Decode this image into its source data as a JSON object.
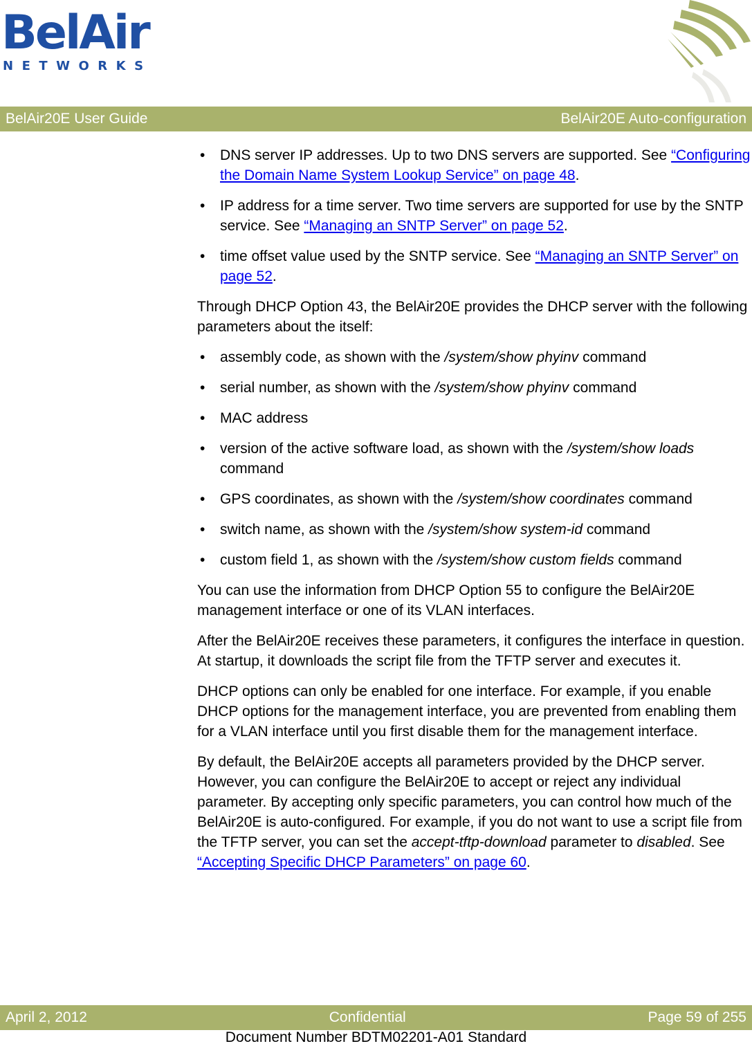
{
  "logo": {
    "brand": "BelAir",
    "sub": "NETWORKS",
    "color": "#1f4fa3"
  },
  "header": {
    "left": "BelAir20E User Guide",
    "right": "BelAir20E Auto-configuration",
    "bar_color": "#a9b26c"
  },
  "content": {
    "bullets1": [
      {
        "text": "DNS server IP addresses. Up to two DNS servers are supported. See ",
        "link": "“Configuring the Domain Name System Lookup Service” on page 48",
        "after": "."
      },
      {
        "text": "IP address for a time server. Two time servers are supported for use by the SNTP service. See ",
        "link": "“Managing an SNTP Server” on page 52",
        "after": "."
      },
      {
        "text": "time offset value used by the SNTP service. See ",
        "link": "“Managing an SNTP Server” on page 52",
        "after": "."
      }
    ],
    "para_option43": "Through DHCP Option 43, the BelAir20E provides the DHCP server with the following parameters about the itself:",
    "bullets2": [
      {
        "text": "assembly code, as shown with the ",
        "cmd": "/system/show phyinv",
        "after": " command"
      },
      {
        "text": "serial number, as shown with the ",
        "cmd": "/system/show phyinv",
        "after": " command"
      },
      {
        "text": "MAC address",
        "cmd": "",
        "after": ""
      },
      {
        "text": "version of the active software load, as shown with the ",
        "cmd": "/system/show loads",
        "after": " command"
      },
      {
        "text": "GPS coordinates, as shown with the ",
        "cmd": "/system/show coordinates",
        "after": " command"
      },
      {
        "text": "switch name, as shown with the ",
        "cmd": "/system/show system-id",
        "after": " command"
      },
      {
        "text": "custom field 1, as shown with the ",
        "cmd": "/system/show custom fields",
        "after": " command"
      }
    ],
    "para_option55": "You can use the information from DHCP Option 55 to configure the BelAir20E management interface or one of its VLAN interfaces.",
    "para_after": "After the BelAir20E receives these parameters, it configures the interface in question. At startup, it downloads the script file from the TFTP server and executes it.",
    "para_one_interface": "DHCP options can only be enabled for one interface. For example, if you enable DHCP options for the management interface, you are prevented from enabling them for a VLAN interface until you first disable them for the management interface.",
    "para_default": {
      "text1": "By default, the BelAir20E accepts all parameters provided by the DHCP server. However, you can configure the BelAir20E to accept or reject any individual parameter. By accepting only specific parameters, you can control how much of the BelAir20E is auto-configured. For example, if you do not want to use a script file from the TFTP server, you can set the ",
      "param": "accept-tftp-download",
      "text2": " parameter to ",
      "value": "disabled",
      "text3": ". See ",
      "link": "“Accepting Specific DHCP Parameters” on page 60",
      "after": "."
    }
  },
  "footer": {
    "date": "April 2, 2012",
    "classification": "Confidential",
    "page": "Page 59 of 255",
    "doc_number": "Document Number BDTM02201-A01 Standard"
  }
}
